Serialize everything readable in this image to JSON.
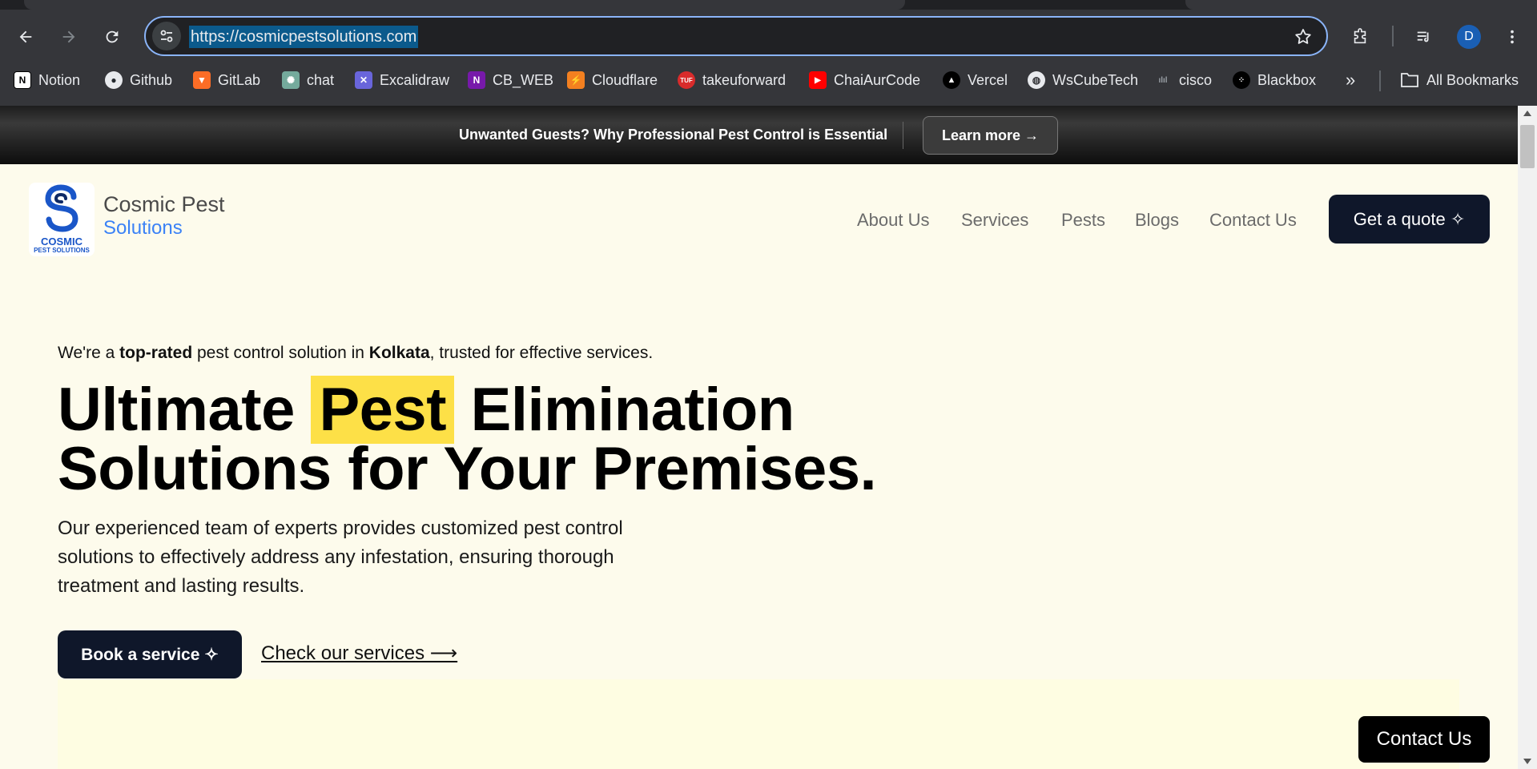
{
  "browser": {
    "url": "https://cosmicpestsolutions.com",
    "profile_initial": "D",
    "bookmarks": [
      {
        "label": "Notion",
        "icon": "notion-icon"
      },
      {
        "label": "Github",
        "icon": "github-icon"
      },
      {
        "label": "GitLab",
        "icon": "gitlab-icon"
      },
      {
        "label": "chat",
        "icon": "chatgpt-icon"
      },
      {
        "label": "Excalidraw",
        "icon": "excalidraw-icon"
      },
      {
        "label": "CB_WEB",
        "icon": "onenote-icon"
      },
      {
        "label": "Cloudflare",
        "icon": "cloudflare-icon"
      },
      {
        "label": "takeuforward",
        "icon": "tuf-icon"
      },
      {
        "label": "ChaiAurCode",
        "icon": "youtube-icon"
      },
      {
        "label": "Vercel",
        "icon": "vercel-icon"
      },
      {
        "label": "WsCubeTech",
        "icon": "globe-icon"
      },
      {
        "label": "cisco",
        "icon": "cisco-icon"
      },
      {
        "label": "Blackbox",
        "icon": "blackbox-icon"
      }
    ],
    "overflow": "»",
    "all_bookmarks": "All Bookmarks"
  },
  "announcement": {
    "text": "Unwanted Guests? Why Professional Pest Control is Essential",
    "button": "Learn more →"
  },
  "header": {
    "logo_line1": "COSMIC",
    "logo_line2": "PEST SOLUTIONS",
    "brand_line1": "Cosmic Pest",
    "brand_line2": "Solutions",
    "nav": [
      "About Us",
      "Services",
      "Pests",
      "Blogs",
      "Contact Us"
    ],
    "cta": "Get a quote ✧"
  },
  "hero": {
    "tagline_pre": "We're a ",
    "tagline_bold1": "top-rated",
    "tagline_mid": " pest control solution in ",
    "tagline_bold2": "Kolkata",
    "tagline_post": ", trusted for effective services.",
    "title_pre": "Ultimate ",
    "title_highlight": "Pest",
    "title_post": " Elimination",
    "title_line2": "Solutions for Your Premises.",
    "description": "Our experienced team of experts provides customized pest control solutions to effectively address any infestation, ensuring thorough treatment and lasting results.",
    "primary_button": "Book a service ✧",
    "secondary_link": "Check our services ⟶"
  },
  "floating_contact": "Contact Us",
  "colors": {
    "page_bg": "#fdfbec",
    "dark_button": "#0f172a",
    "highlight": "#fde047",
    "brand_blue": "#3b82f6"
  }
}
